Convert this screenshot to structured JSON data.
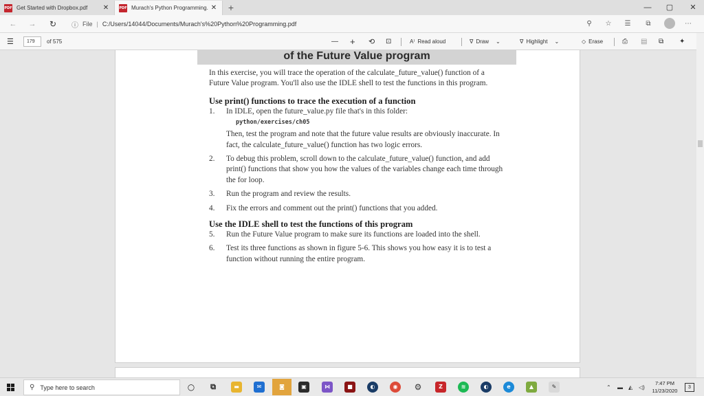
{
  "browser": {
    "tabs": [
      {
        "title": "Get Started with Dropbox.pdf",
        "icon": "pdf-icon",
        "active": false
      },
      {
        "title": "Murach's Python Programming.",
        "icon": "pdf-icon",
        "active": true
      }
    ],
    "new_tab_label": "+",
    "address": {
      "scheme_label": "File",
      "url": "C:/Users/14044/Documents/Murach's%20Python%20Programming.pdf"
    }
  },
  "pdf_toolbar": {
    "current_page": "179",
    "page_total": "of 575",
    "zoom_out": "—",
    "zoom_in": "+",
    "read_aloud": "Read aloud",
    "draw": "Draw",
    "highlight": "Highlight",
    "erase": "Erase"
  },
  "document": {
    "heading": "of the Future Value program",
    "intro": "In this exercise, you will trace the operation of the calculate_future_value() function of a Future Value program. You'll also use the IDLE shell to test the functions in this program.",
    "section1": {
      "title": "Use print() functions to trace the execution of a function",
      "steps": [
        {
          "num": "1.",
          "text": "In IDLE, open the future_value.py file that's in this folder:",
          "code": "python/exercises/ch05",
          "after": "Then, test the program and note that the future value results are obviously inaccurate. In fact, the calculate_future_value() function has two logic errors."
        },
        {
          "num": "2.",
          "text": "To debug this problem, scroll down to the calculate_future_value() function, and add print() functions that show you how the values of the variables change each time through the for loop."
        },
        {
          "num": "3.",
          "text": "Run the program and review the results."
        },
        {
          "num": "4.",
          "text": "Fix the errors and comment out the print() functions that you added."
        }
      ]
    },
    "section2": {
      "title": "Use the IDLE shell to test the functions of this program",
      "steps": [
        {
          "num": "5.",
          "text": "Run the Future Value program to make sure its functions are loaded into the shell."
        },
        {
          "num": "6.",
          "text": "Test its three functions as shown in figure 5-6. This shows you how easy it is to test a function without running the entire program."
        }
      ]
    }
  },
  "taskbar": {
    "search_placeholder": "Type here to search",
    "time": "7:47 PM",
    "date": "11/23/2020",
    "notifications_count": "3"
  },
  "colors": {
    "pdf_red": "#c4262e",
    "heading_bar": "#d3d3d3",
    "viewer_bg": "#e6e6e6"
  }
}
